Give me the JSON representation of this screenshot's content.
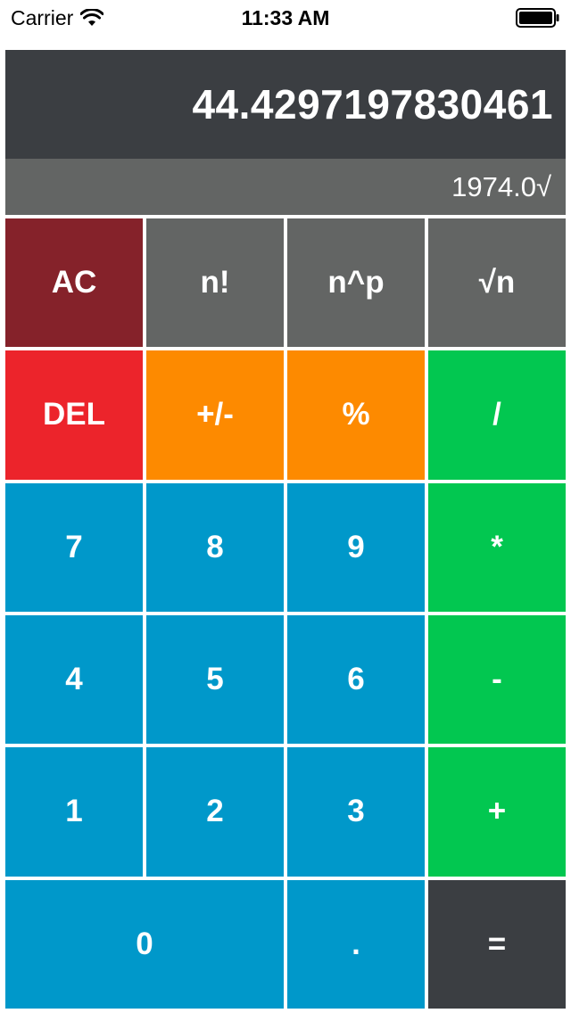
{
  "status_bar": {
    "carrier": "Carrier",
    "time": "11:33 AM",
    "wifi_icon": "wifi-icon",
    "battery_icon": "battery-icon"
  },
  "display": {
    "result": "44.4297197830461",
    "expression": "1974.0√"
  },
  "keys": {
    "ac": "AC",
    "factorial": "n!",
    "power": "n^p",
    "sqrt": "√n",
    "del": "DEL",
    "sign": "+/-",
    "percent": "%",
    "divide": "/",
    "seven": "7",
    "eight": "8",
    "nine": "9",
    "multiply": "*",
    "four": "4",
    "five": "5",
    "six": "6",
    "minus": "-",
    "one": "1",
    "two": "2",
    "three": "3",
    "plus": "+",
    "zero": "0",
    "decimal": ".",
    "equals": "="
  },
  "colors": {
    "display_main_bg": "#3b3e42",
    "display_sub_bg": "#636564",
    "ac": "#85222a",
    "function": "#636564",
    "delete": "#ec242b",
    "orange": "#fd8a00",
    "operator": "#02c750",
    "digit": "#0098ca",
    "equals": "#3b3e42"
  }
}
